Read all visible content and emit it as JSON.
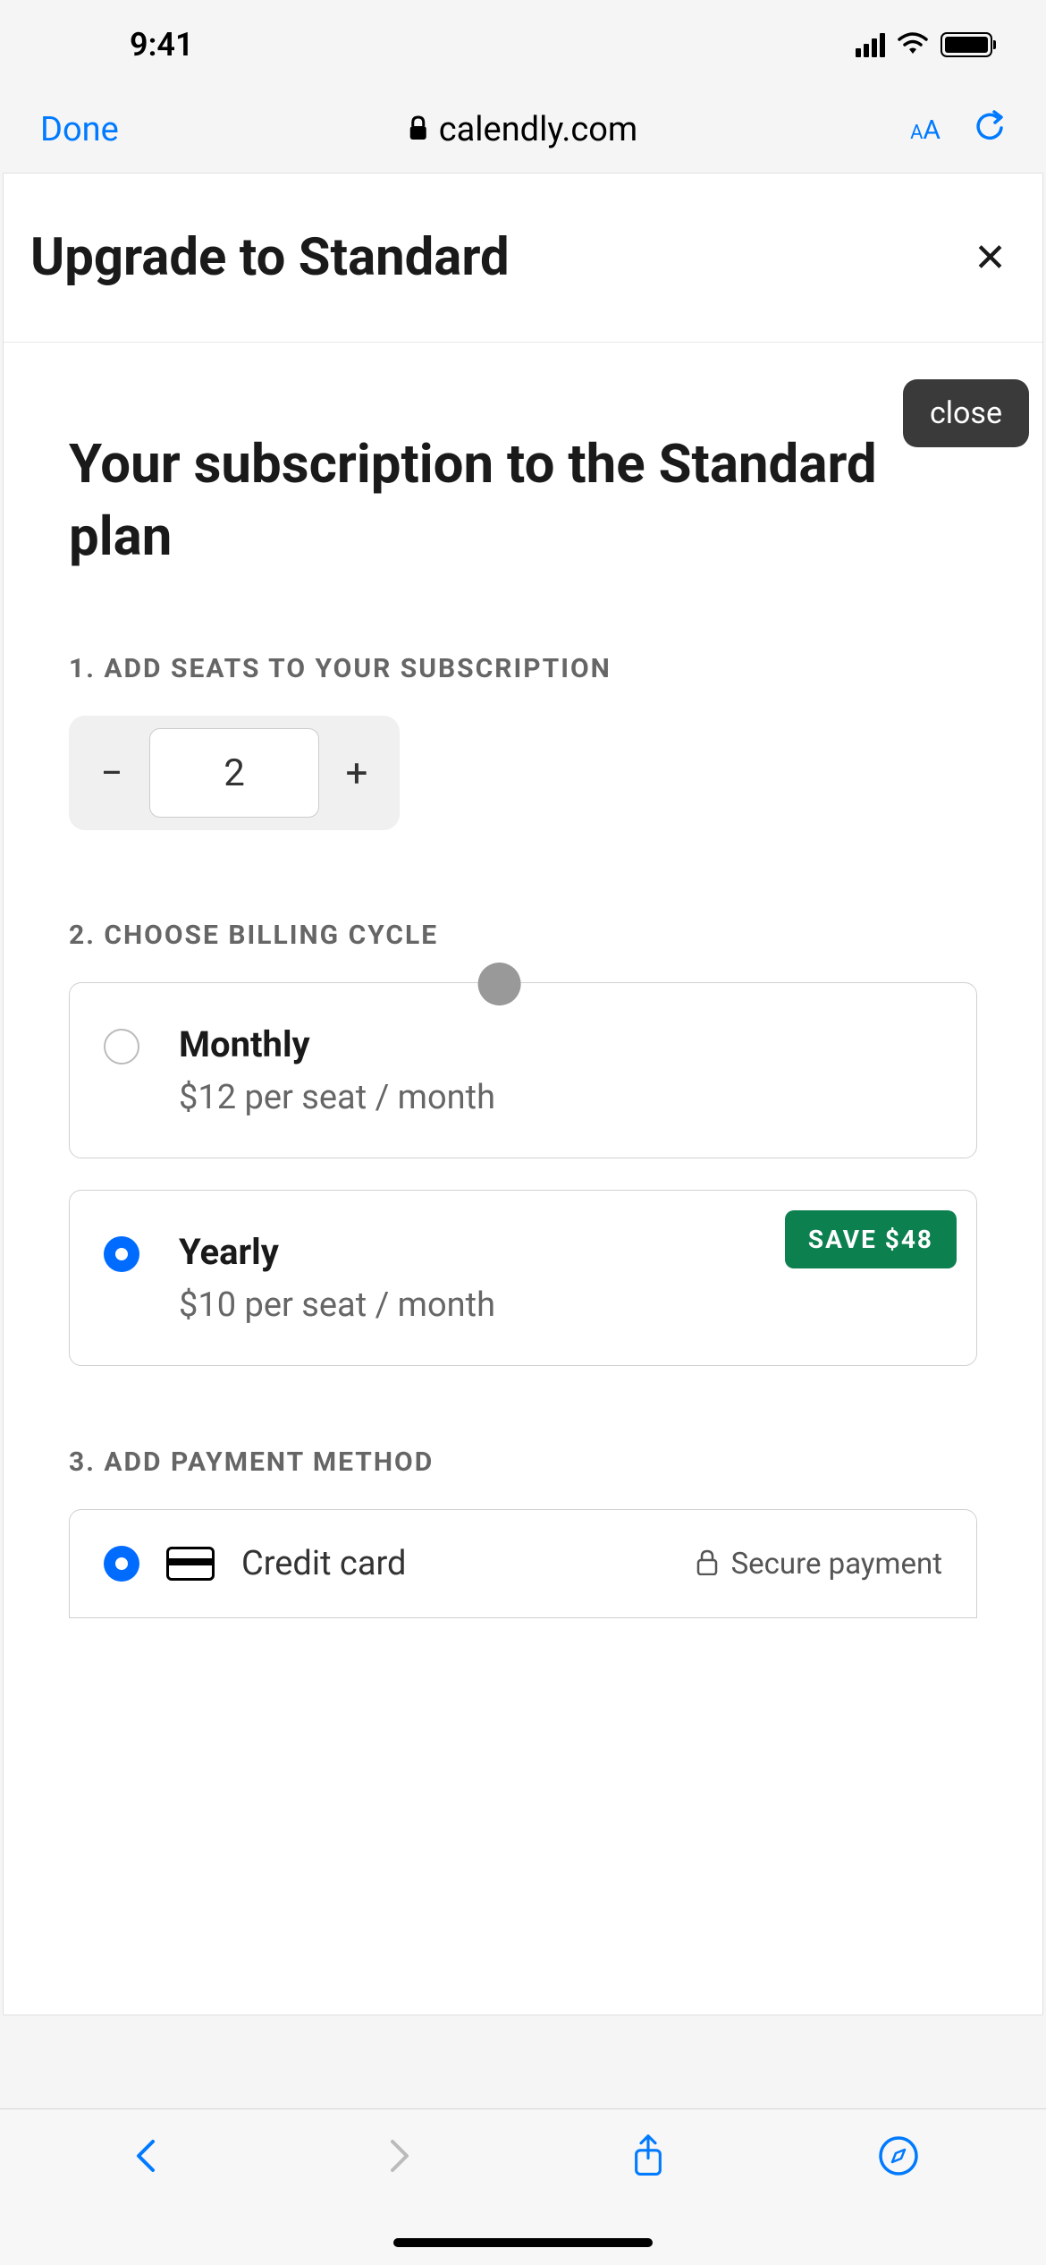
{
  "status": {
    "time": "9:41"
  },
  "browser": {
    "done_label": "Done",
    "url": "calendly.com",
    "text_size": "AA"
  },
  "page": {
    "title": "Upgrade to Standard",
    "close_tooltip": "close",
    "subscription_title": "Your subscription to the Standard plan"
  },
  "seats": {
    "label": "1. Add seats to your subscription",
    "value": "2",
    "minus": "−",
    "plus": "+"
  },
  "billing": {
    "label": "2. Choose billing cycle",
    "options": [
      {
        "name": "Monthly",
        "price": "$12 per seat / month",
        "selected": false
      },
      {
        "name": "Yearly",
        "price": "$10 per seat / month",
        "selected": true,
        "badge": "SAVE $48"
      }
    ]
  },
  "payment": {
    "label": "3. Add payment method",
    "method_label": "Credit card",
    "secure_label": "Secure payment"
  }
}
